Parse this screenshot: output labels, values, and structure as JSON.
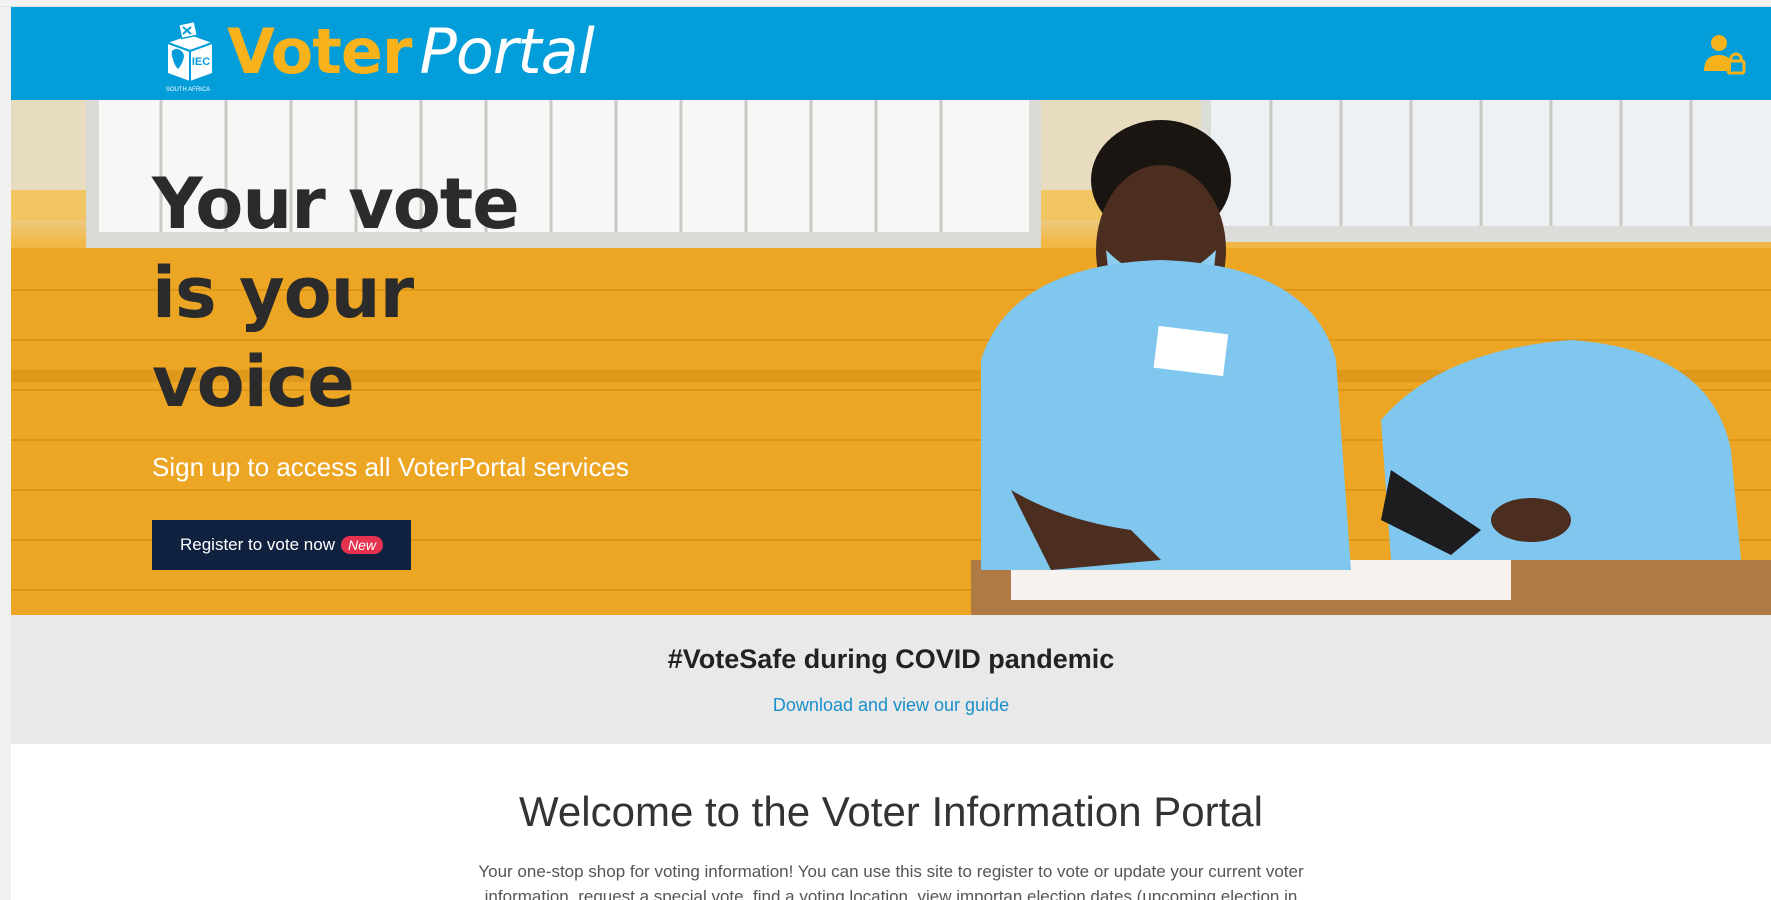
{
  "header": {
    "brand_voter": "Voter",
    "brand_portal": "Portal",
    "logo_text": "IEC",
    "logo_country": "SOUTH AFRICA",
    "account_icon": "user-lock-icon"
  },
  "hero": {
    "title_lines": [
      "Your vote",
      "is your",
      "voice"
    ],
    "subtitle": "Sign up to access all VoterPortal services",
    "register_label": "Register to vote now",
    "badge_label": "New"
  },
  "covid": {
    "title": "#VoteSafe during COVID pandemic",
    "link": "Download and view our guide"
  },
  "welcome": {
    "title": "Welcome to the Voter Information Portal",
    "text": "Your one-stop shop for voting information! You can use this site to register to vote or update your current voter information, request a special vote, find a voting location, view importan election dates (upcoming election in"
  },
  "colors": {
    "header_bg": "#039ed9",
    "brand_yellow": "#f7b21c",
    "button_navy": "#10213f",
    "badge_red": "#e5334f",
    "link_blue": "#1a8fcc"
  }
}
